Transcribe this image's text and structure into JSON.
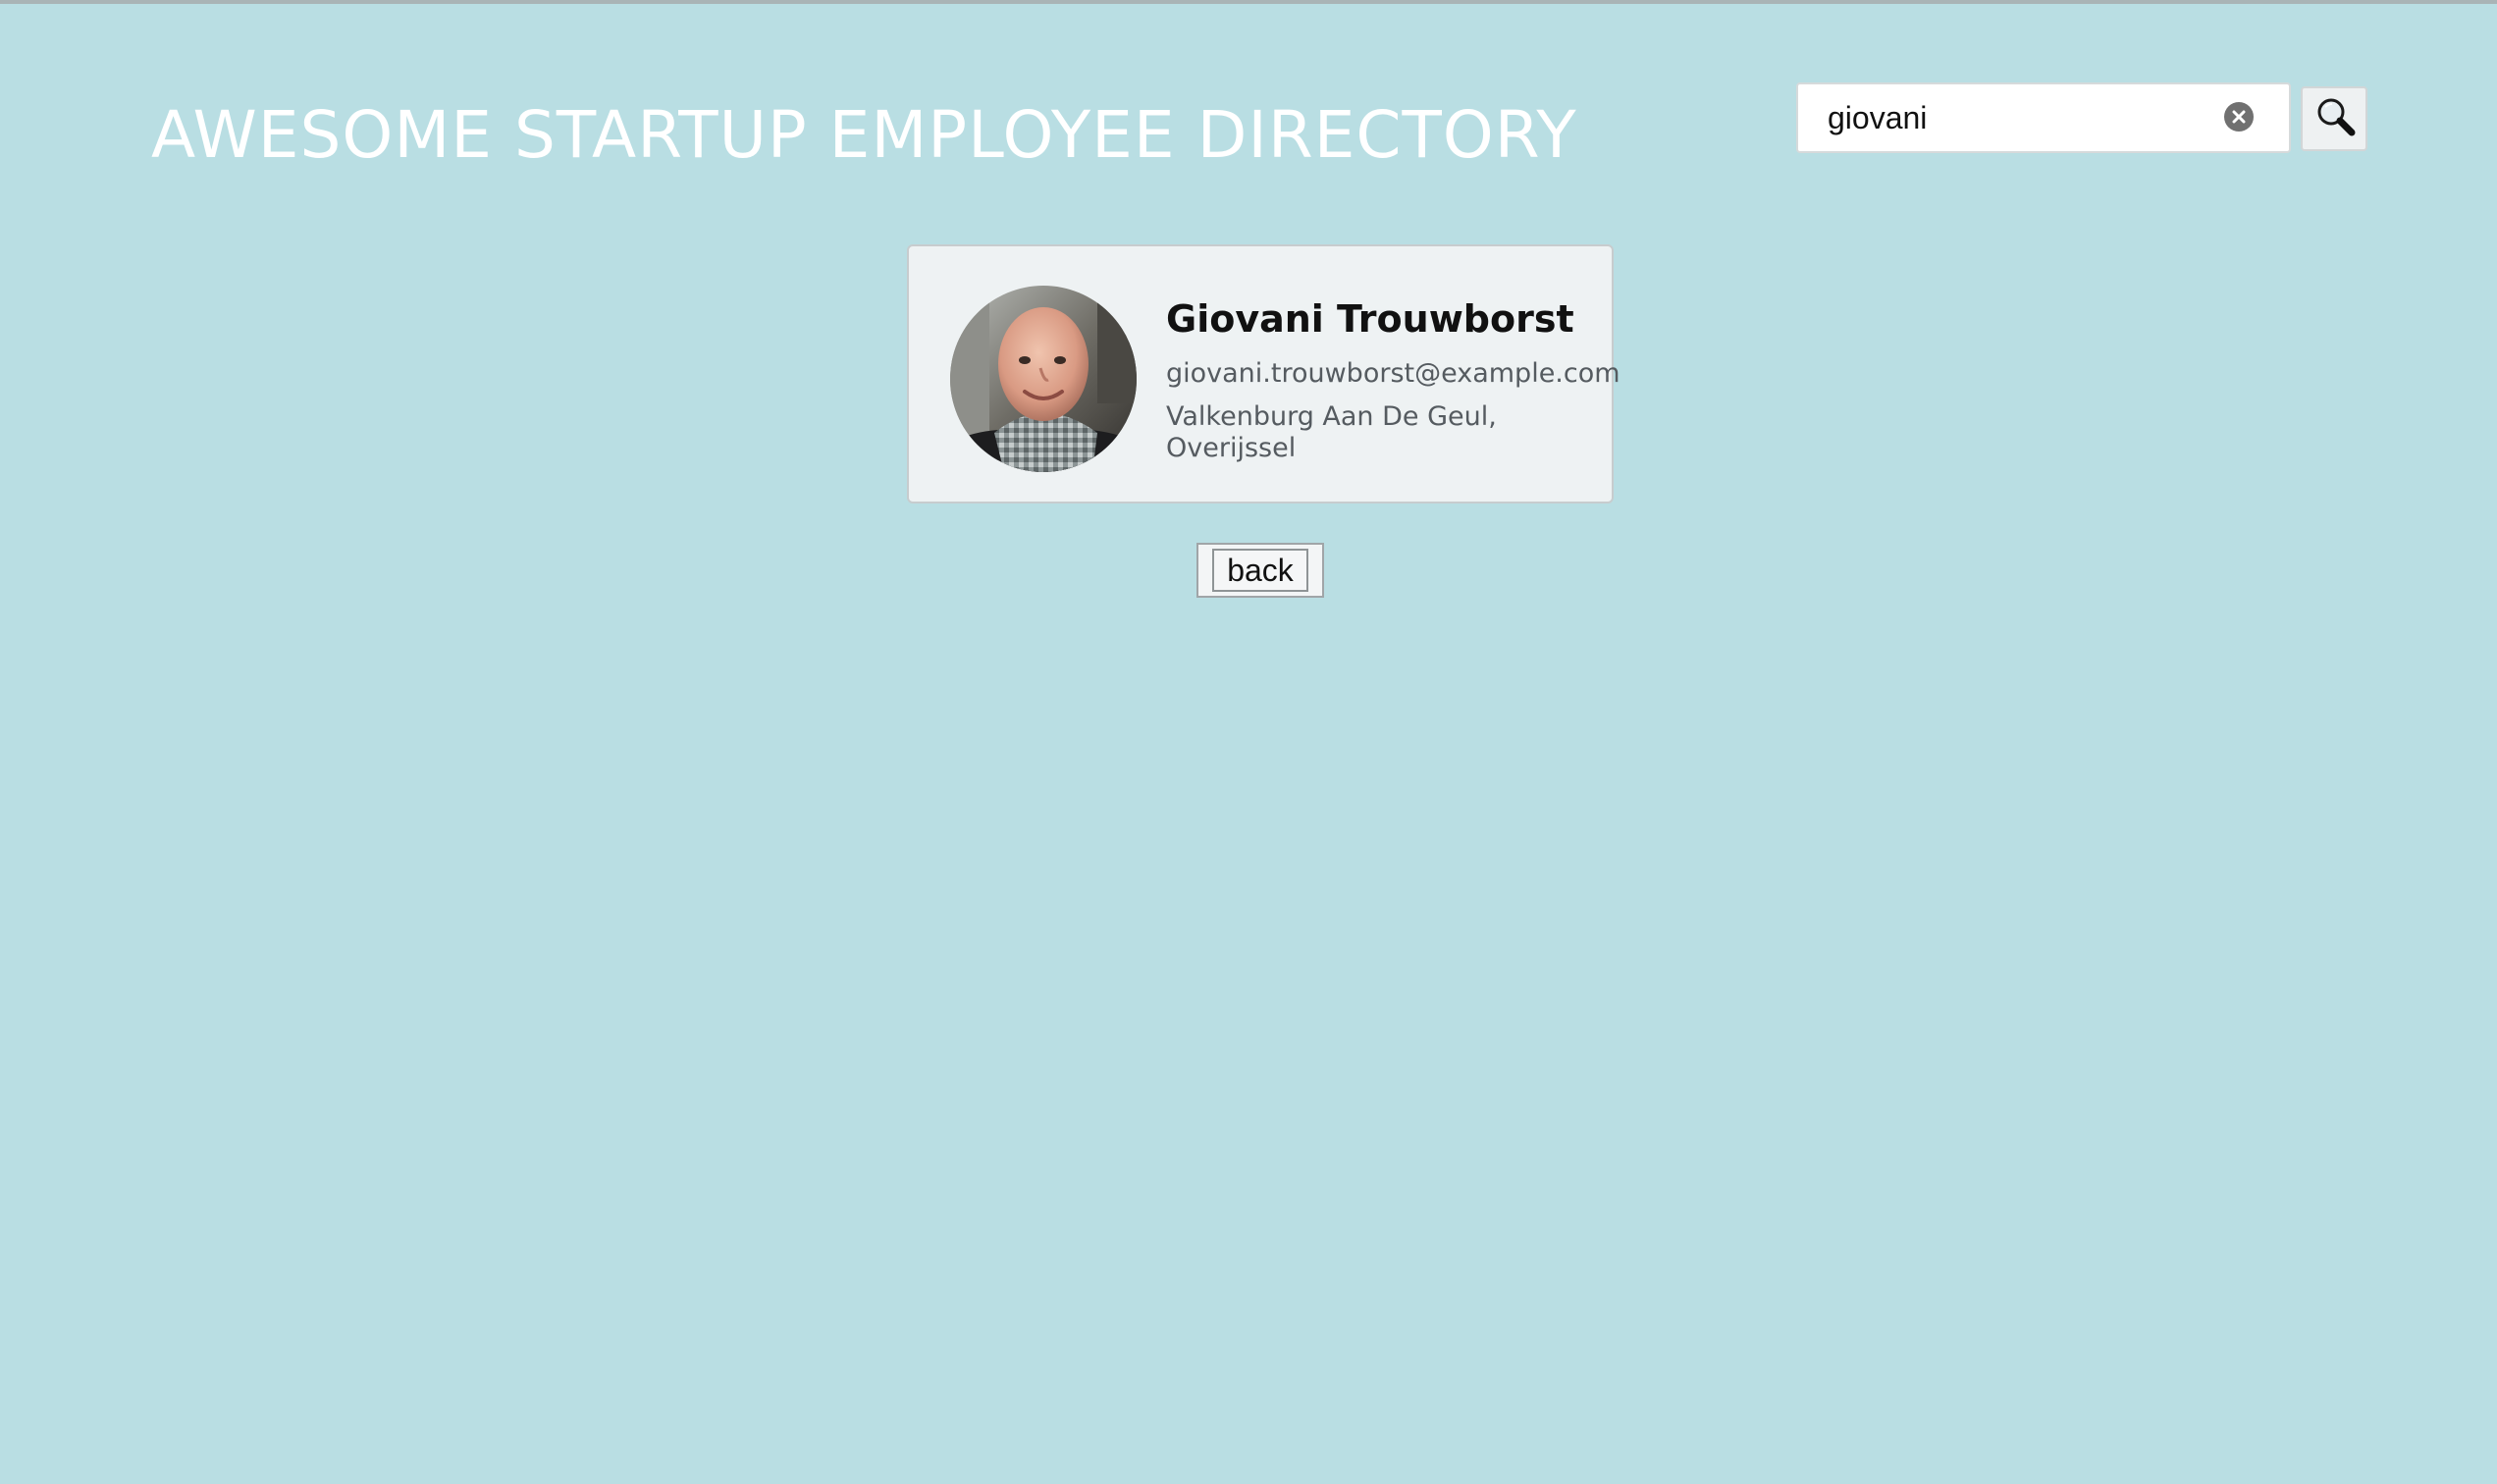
{
  "header": {
    "title": "AWESOME STARTUP EMPLOYEE DIRECTORY"
  },
  "search": {
    "value": "giovani",
    "clear_icon": "clear-x-circle-icon",
    "submit_icon": "magnifier-icon"
  },
  "employee": {
    "name": "Giovani Trouwborst",
    "email": "giovani.trouwborst@example.com",
    "location": "Valkenburg Aan De Geul, Overijssel",
    "avatar_icon": "employee-photo"
  },
  "navigation": {
    "back_label": "back"
  },
  "colors": {
    "background": "#b9dee3",
    "card_background": "#eef2f3",
    "title_text": "#ffffff",
    "secondary_text": "#555b60"
  }
}
